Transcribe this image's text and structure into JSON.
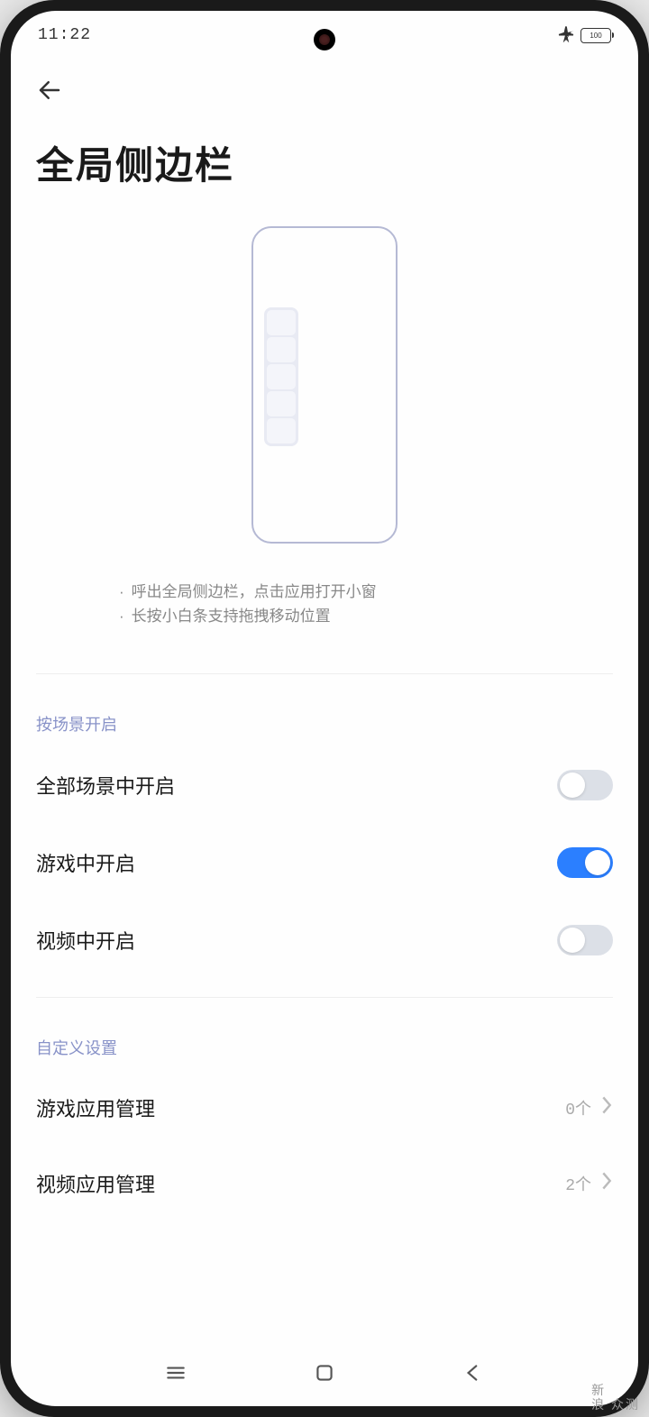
{
  "status": {
    "time": "11:22",
    "battery": "100"
  },
  "header": {
    "title": "全局侧边栏"
  },
  "hints": {
    "line1": "呼出全局侧边栏，点击应用打开小窗",
    "line2": "长按小白条支持拖拽移动位置"
  },
  "sections": {
    "scenes": {
      "header": "按场景开启",
      "items": [
        {
          "label": "全部场景中开启",
          "on": false
        },
        {
          "label": "游戏中开启",
          "on": true
        },
        {
          "label": "视频中开启",
          "on": false
        }
      ]
    },
    "custom": {
      "header": "自定义设置",
      "items": [
        {
          "label": "游戏应用管理",
          "value": "0个"
        },
        {
          "label": "视频应用管理",
          "value": "2个"
        }
      ]
    }
  },
  "watermark": {
    "line1": "新",
    "line2": "浪 众测"
  }
}
